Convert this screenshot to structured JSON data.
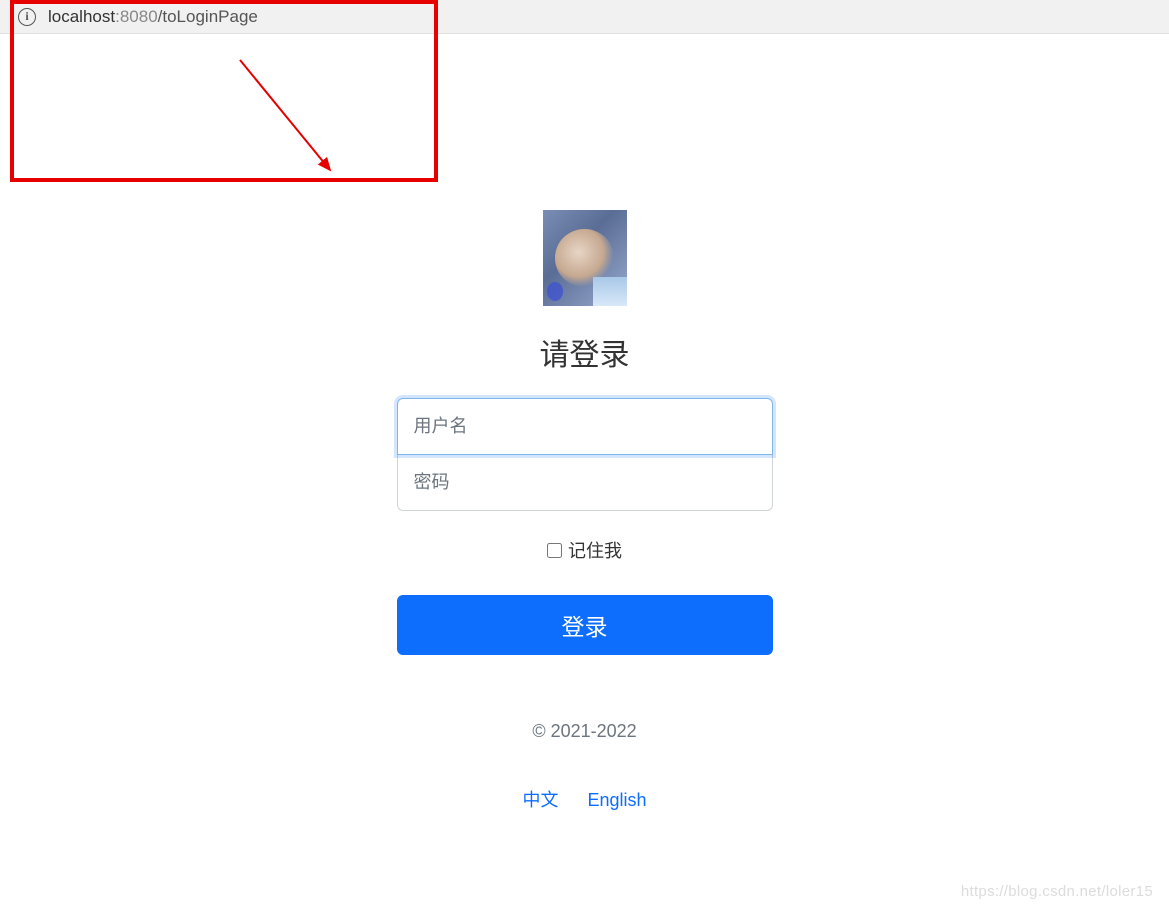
{
  "addressBar": {
    "host": "localhost",
    "port": ":8080",
    "path": "/toLoginPage"
  },
  "login": {
    "title": "请登录",
    "usernamePlaceholder": "用户名",
    "passwordPlaceholder": "密码",
    "rememberLabel": "记住我",
    "submitLabel": "登录",
    "copyright": "© 2021-2022",
    "langZh": "中文",
    "langEn": "English"
  },
  "watermark": "https://blog.csdn.net/loler15"
}
